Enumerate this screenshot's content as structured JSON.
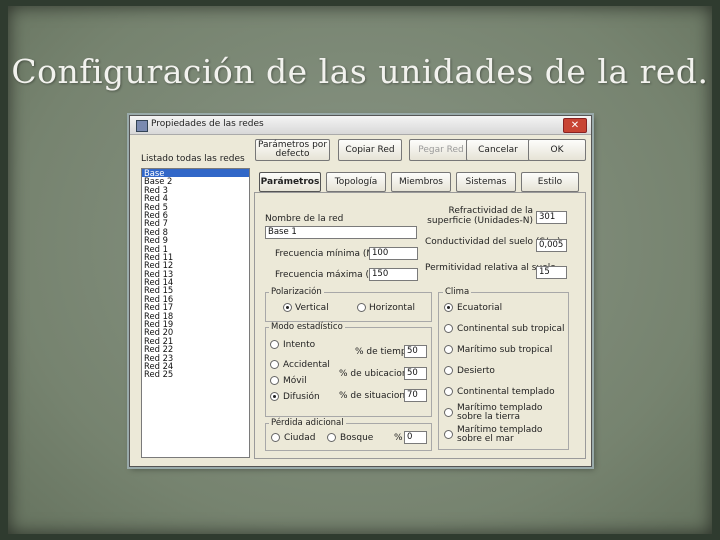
{
  "slide": {
    "title": "Configuración de las unidades de la red."
  },
  "window": {
    "title": "Propiedades de las redes",
    "close_label": "✕"
  },
  "buttons": {
    "defaults": "Parámetros por defecto",
    "copy": "Copiar Red",
    "paste": "Pegar Red",
    "cancel": "Cancelar",
    "ok": "OK"
  },
  "list": {
    "label": "Listado todas las redes",
    "items": [
      "Base",
      "Base 2",
      "Red 3",
      "Red 4",
      "Red 5",
      "Red 6",
      "Red 7",
      "Red 8",
      "Red 9",
      "Red 1",
      "Red 11",
      "Red 12",
      "Red 13",
      "Red 14",
      "Red 15",
      "Red 16",
      "Red 17",
      "Red 18",
      "Red 19",
      "Red 20",
      "Red 21",
      "Red 22",
      "Red 23",
      "Red 24",
      "Red 25"
    ],
    "selected_index": 0
  },
  "tabs": [
    "Parámetros",
    "Topología",
    "Miembros",
    "Sistemas",
    "Estilo"
  ],
  "params": {
    "name_label": "Nombre de la red",
    "name_value": "Base 1",
    "freq_min_label": "Frecuencia mínima (MHz)",
    "freq_min_value": "100",
    "freq_max_label": "Frecuencia máxima (MHz)",
    "freq_max_value": "150",
    "refractivity_label": "Refractividad de la superficie (Unidades-N)",
    "refractivity_value": "301",
    "conductivity_label": "Conductividad del suelo (S/m)",
    "conductivity_value": "0,005",
    "permittivity_label": "Permitividad relativa al suelo",
    "permittivity_value": "15"
  },
  "polarization": {
    "label": "Polarización",
    "options": [
      "Vertical",
      "Horizontal"
    ],
    "selected_index": 0
  },
  "stat_mode": {
    "label": "Modo estadístico",
    "options": [
      "Intento",
      "Accidental",
      "Móvil",
      "Difusión"
    ],
    "selected_index": 3,
    "fields": [
      {
        "label": "% de tiempo",
        "value": "50"
      },
      {
        "label": "% de ubicaciones",
        "value": "50"
      },
      {
        "label": "% de situaciones",
        "value": "70"
      }
    ]
  },
  "extra_loss": {
    "label": "Pérdida adicional",
    "options": [
      "Ciudad",
      "Bosque"
    ],
    "pct_label": "%",
    "pct_value": "0"
  },
  "climate": {
    "label": "Clima",
    "options": [
      "Ecuatorial",
      "Continental sub tropical",
      "Marítimo sub tropical",
      "Desierto",
      "Continental templado",
      "Marítimo templado sobre la tierra",
      "Marítimo templado sobre el mar"
    ],
    "selected_index": 0
  }
}
